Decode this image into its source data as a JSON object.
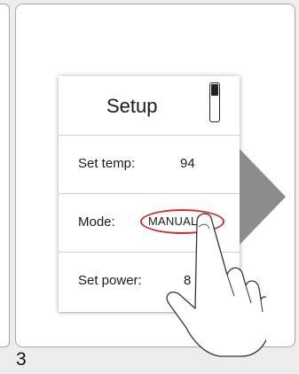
{
  "step": {
    "number": "3"
  },
  "device": {
    "title": "Setup",
    "rows": [
      {
        "label": "Set temp:",
        "value": "94"
      },
      {
        "label": "Mode:",
        "value": "MANUAL",
        "highlighted": true
      },
      {
        "label": "Set power:",
        "value": "8"
      }
    ],
    "level_meter": {
      "level_fraction": 0.3
    }
  },
  "icons": {
    "next": "triangle-arrow-right-icon",
    "pointer": "pointing-hand-icon"
  },
  "colors": {
    "highlight": "#d32f2f",
    "arrow": "#8c8c8c",
    "panel_border": "#a9a9a9",
    "background": "#ededed"
  }
}
